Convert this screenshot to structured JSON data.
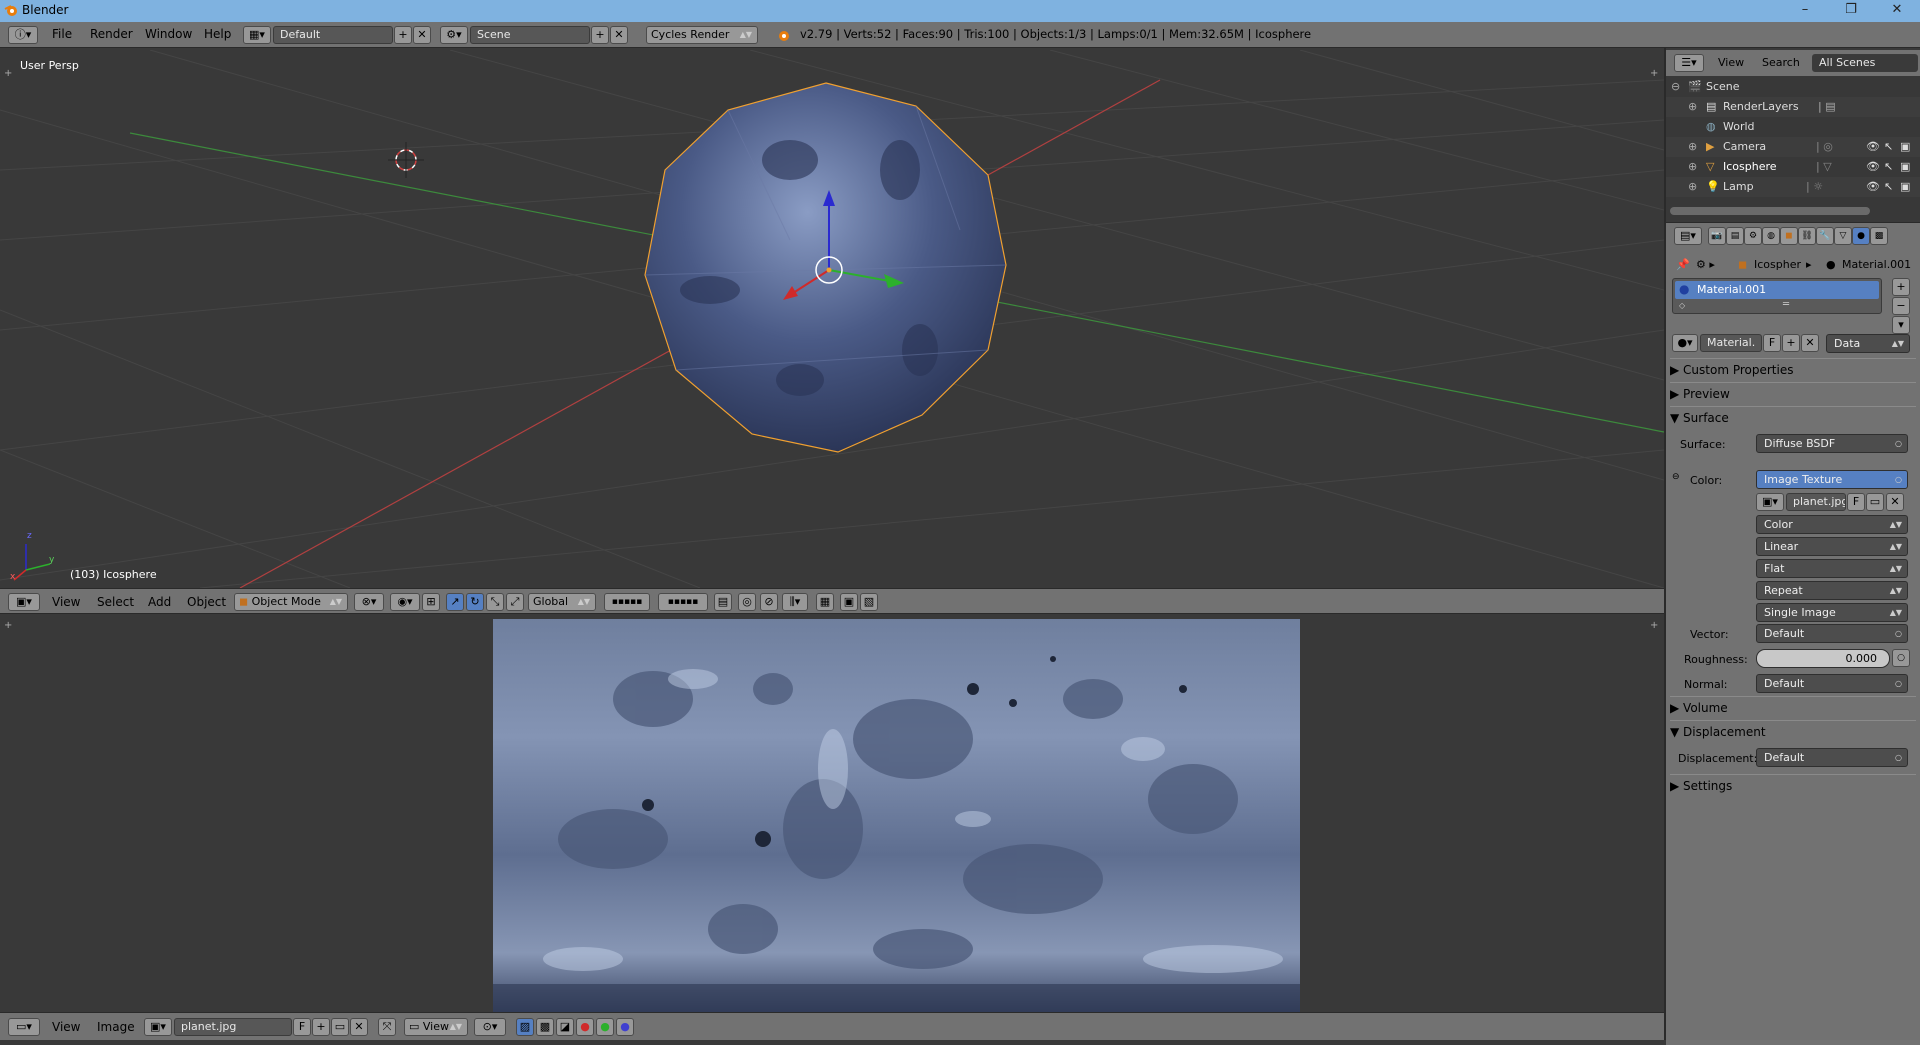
{
  "window": {
    "title": "Blender",
    "minimize": "–",
    "maximize": "❐",
    "close": "✕"
  },
  "infobar": {
    "menus": [
      "File",
      "Render",
      "Window",
      "Help"
    ],
    "layout": "Default",
    "scene": "Scene",
    "engine": "Cycles Render",
    "stats": "v2.79 | Verts:52 | Faces:90 | Tris:100 | Objects:1/3 | Lamps:0/1 | Mem:32.65M | Icosphere"
  },
  "viewport": {
    "label": "User Persp",
    "object_info": "(103) Icosphere",
    "axis_x": "x",
    "axis_y": "y",
    "axis_z": "z"
  },
  "viewport_header": {
    "menus": [
      "View",
      "Select",
      "Add",
      "Object"
    ],
    "mode": "Object Mode",
    "orientation": "Global"
  },
  "image_header": {
    "menus": [
      "View",
      "Image"
    ],
    "image_name": "planet.jpg",
    "fake_user": "F",
    "view": "View"
  },
  "outliner": {
    "header_menus": [
      "View",
      "Search"
    ],
    "filter": "All Scenes",
    "items": [
      {
        "label": "Scene",
        "icon": "scene-icon"
      },
      {
        "label": "RenderLayers",
        "icon": "renderlayers-icon"
      },
      {
        "label": "World",
        "icon": "world-icon"
      },
      {
        "label": "Camera",
        "icon": "camera-icon"
      },
      {
        "label": "Icosphere",
        "icon": "mesh-icon"
      },
      {
        "label": "Lamp",
        "icon": "lamp-icon"
      }
    ]
  },
  "properties": {
    "breadcrumb": {
      "object": "Icospher",
      "material": "Material.001"
    },
    "slot": "Material.001",
    "material_name": "Material.",
    "fake_user": "F",
    "link": "Data",
    "panels": {
      "custom_properties": "Custom Properties",
      "preview": "Preview",
      "surface": "Surface",
      "volume": "Volume",
      "displacement": "Displacement",
      "settings": "Settings"
    },
    "surface_label": "Surface:",
    "surface_value": "Diffuse BSDF",
    "color_label": "Color:",
    "color_value": "Image Texture",
    "texture_image": "planet.jpg",
    "texture_fake": "F",
    "texture_options": [
      "Color",
      "Linear",
      "Flat",
      "Repeat",
      "Single Image"
    ],
    "vector_label": "Vector:",
    "vector_value": "Default",
    "roughness_label": "Roughness:",
    "roughness_value": "0.000",
    "normal_label": "Normal:",
    "normal_value": "Default",
    "displacement_label": "Displacement:",
    "displacement_value": "Default"
  },
  "colors": {
    "selection": "#f0a030",
    "accent": "#5680c2",
    "axis_x": "#b04040",
    "axis_y": "#3c8a3c"
  }
}
